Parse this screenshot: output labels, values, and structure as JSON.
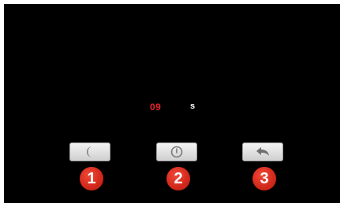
{
  "timer": {
    "value": "09",
    "unit": "s",
    "value_color": "#e8232a"
  },
  "buttons": [
    {
      "name": "sleep",
      "icon": "moon-icon"
    },
    {
      "name": "power",
      "icon": "power-icon"
    },
    {
      "name": "back",
      "icon": "undo-arrow-icon"
    }
  ],
  "markers": [
    "1",
    "2",
    "3"
  ],
  "colors": {
    "screen_background": "#000000",
    "marker": "#d42a1c",
    "button": "#e6e6e6"
  }
}
